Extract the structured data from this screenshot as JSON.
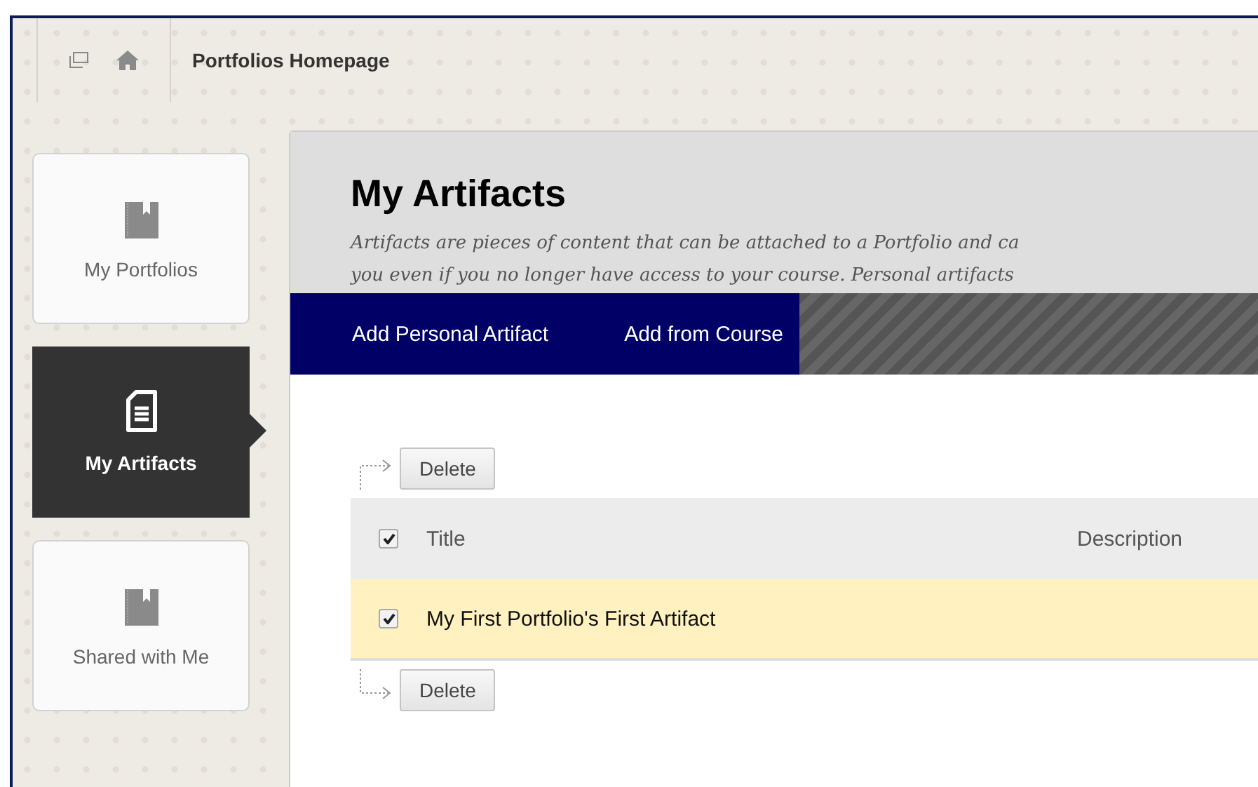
{
  "breadcrumb": {
    "title": "Portfolios Homepage"
  },
  "sidebar": {
    "items": [
      {
        "label": "My Portfolios",
        "kind": "book",
        "selected": false
      },
      {
        "label": "My Artifacts",
        "kind": "document",
        "selected": true
      },
      {
        "label": "Shared with Me",
        "kind": "book",
        "selected": false
      }
    ]
  },
  "page": {
    "title": "My Artifacts",
    "description": [
      "Artifacts are pieces of content that can be attached to a Portfolio and ca",
      "you even if you no longer have access to your course. Personal artifacts"
    ]
  },
  "actions": [
    "Add Personal Artifact",
    "Add from Course"
  ],
  "top_button": "Delete",
  "table": {
    "select_all": {
      "checked": true
    },
    "columns": [
      "Title",
      "Description"
    ],
    "rows": [
      {
        "title": "My First Portfolio's First Artifact",
        "checked": true
      }
    ]
  },
  "bottom_button": "Delete"
}
